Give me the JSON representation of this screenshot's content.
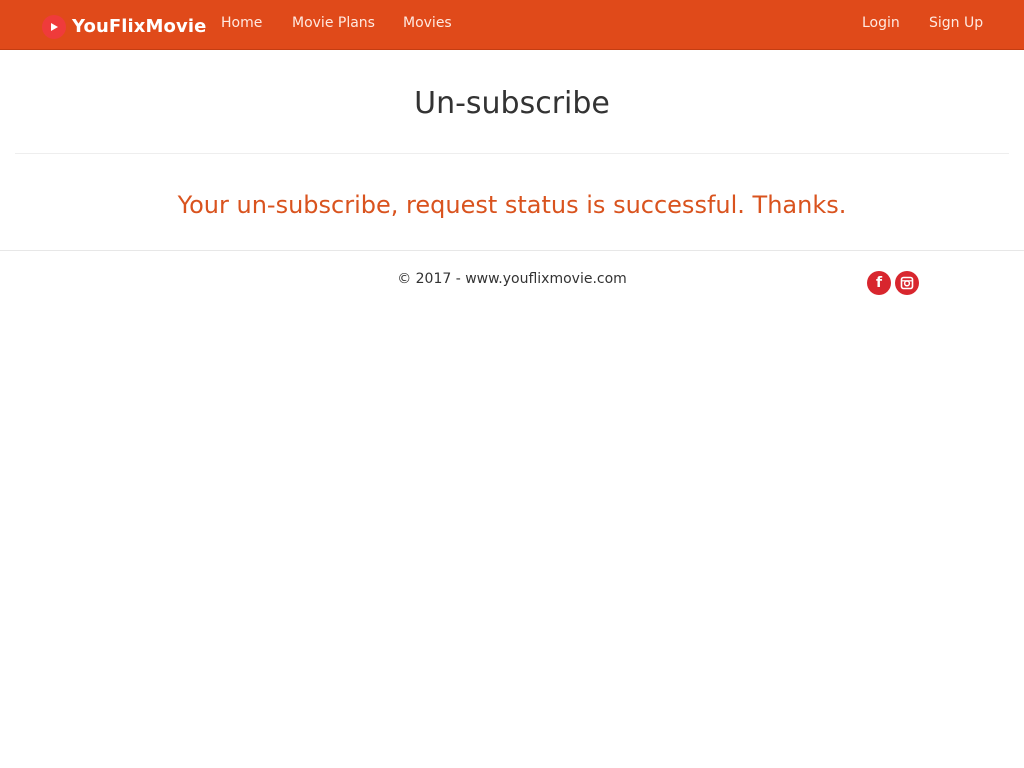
{
  "nav": {
    "brand": "YouFlixMovie",
    "links": [
      "Home",
      "Movie Plans",
      "Movies"
    ],
    "auth": [
      "Login",
      "Sign Up"
    ]
  },
  "main": {
    "title": "Un-subscribe",
    "message": "Your un-subscribe, request status is successful. Thanks."
  },
  "footer": {
    "copyright": "© 2017 - www.youflixmovie.com",
    "social": [
      "facebook-icon",
      "instagram-icon"
    ],
    "fb_glyph": "f"
  },
  "colors": {
    "navbar": "#e04a1a",
    "message": "#d9531e",
    "social": "#d8262e"
  }
}
